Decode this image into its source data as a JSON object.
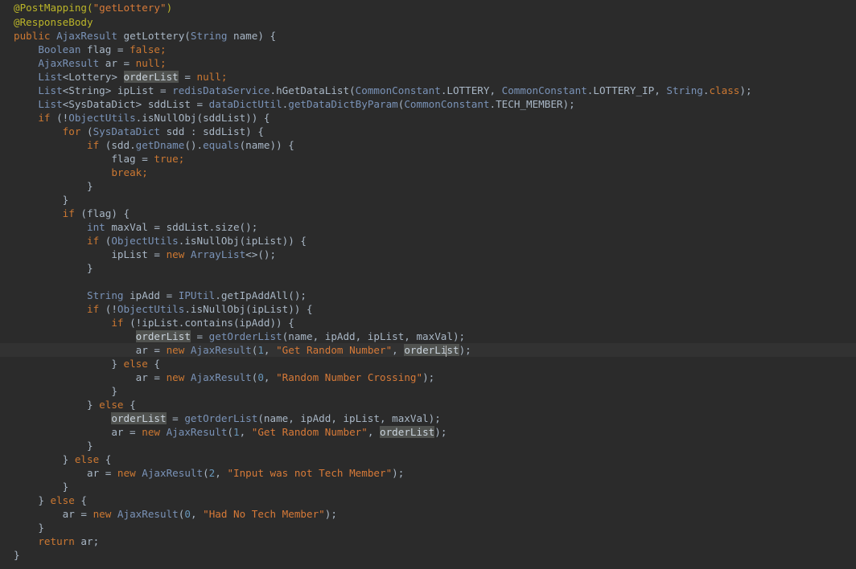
{
  "editor": {
    "colors": {
      "background": "#2b2b2b",
      "current_line": "#323232",
      "text": "#a9b7c6",
      "keyword": "#cc7832",
      "string": "#d77a38",
      "annotation": "#bbb529",
      "type": "#6897bb",
      "highlight": "#50524f"
    },
    "current_line_index": 25,
    "lines": [
      [
        {
          "t": "@PostMapping(",
          "c": "ann"
        },
        {
          "t": "\"getLottery\"",
          "c": "str"
        },
        {
          "t": ")",
          "c": "ann"
        }
      ],
      [
        {
          "t": "@ResponseBody",
          "c": "ann"
        }
      ],
      [
        {
          "t": "public ",
          "c": "kw"
        },
        {
          "t": "AjaxResult",
          "c": "cls"
        },
        {
          "t": " getLottery(",
          "c": "txt"
        },
        {
          "t": "String",
          "c": "cls"
        },
        {
          "t": " name) {",
          "c": "txt"
        }
      ],
      [
        {
          "t": "    ",
          "c": "txt"
        },
        {
          "t": "Boolean",
          "c": "cls"
        },
        {
          "t": " flag = ",
          "c": "txt"
        },
        {
          "t": "false",
          "c": "kw"
        },
        {
          "t": ";",
          "c": "kw"
        }
      ],
      [
        {
          "t": "    ",
          "c": "txt"
        },
        {
          "t": "AjaxResult",
          "c": "cls"
        },
        {
          "t": " ar = ",
          "c": "txt"
        },
        {
          "t": "null",
          "c": "kw"
        },
        {
          "t": ";",
          "c": "kw"
        }
      ],
      [
        {
          "t": "    ",
          "c": "txt"
        },
        {
          "t": "List",
          "c": "cls"
        },
        {
          "t": "<Lottery> ",
          "c": "txt"
        },
        {
          "t": "orderList",
          "c": "hl"
        },
        {
          "t": " = ",
          "c": "txt"
        },
        {
          "t": "null",
          "c": "kw"
        },
        {
          "t": ";",
          "c": "kw"
        }
      ],
      [
        {
          "t": "    ",
          "c": "txt"
        },
        {
          "t": "List",
          "c": "cls"
        },
        {
          "t": "<String> ipList = ",
          "c": "txt"
        },
        {
          "t": "redisDataService",
          "c": "cls"
        },
        {
          "t": ".hGetDataList(",
          "c": "txt"
        },
        {
          "t": "CommonConstant",
          "c": "cls"
        },
        {
          "t": ".LOTTERY, ",
          "c": "txt"
        },
        {
          "t": "CommonConstant",
          "c": "cls"
        },
        {
          "t": ".LOTTERY_IP, ",
          "c": "txt"
        },
        {
          "t": "String",
          "c": "cls"
        },
        {
          "t": ".",
          "c": "txt"
        },
        {
          "t": "class",
          "c": "kw"
        },
        {
          "t": ");",
          "c": "txt"
        }
      ],
      [
        {
          "t": "    ",
          "c": "txt"
        },
        {
          "t": "List",
          "c": "cls"
        },
        {
          "t": "<SysDataDict> sddList = ",
          "c": "txt"
        },
        {
          "t": "dataDictUtil",
          "c": "cls"
        },
        {
          "t": ".",
          "c": "txt"
        },
        {
          "t": "getDataDictByParam",
          "c": "cls"
        },
        {
          "t": "(",
          "c": "txt"
        },
        {
          "t": "CommonConstant",
          "c": "cls"
        },
        {
          "t": ".TECH_MEMBER);",
          "c": "txt"
        }
      ],
      [
        {
          "t": "    ",
          "c": "txt"
        },
        {
          "t": "if",
          "c": "kw"
        },
        {
          "t": " (!",
          "c": "txt"
        },
        {
          "t": "ObjectUtils",
          "c": "cls"
        },
        {
          "t": ".isNullObj(sddList)) {",
          "c": "txt"
        }
      ],
      [
        {
          "t": "        ",
          "c": "txt"
        },
        {
          "t": "for",
          "c": "kw"
        },
        {
          "t": " (",
          "c": "txt"
        },
        {
          "t": "SysDataDict",
          "c": "cls"
        },
        {
          "t": " sdd : sddList) {",
          "c": "txt"
        }
      ],
      [
        {
          "t": "            ",
          "c": "txt"
        },
        {
          "t": "if",
          "c": "kw"
        },
        {
          "t": " (sdd.",
          "c": "txt"
        },
        {
          "t": "getDname",
          "c": "cls"
        },
        {
          "t": "().",
          "c": "txt"
        },
        {
          "t": "equals",
          "c": "cls"
        },
        {
          "t": "(name)) {",
          "c": "txt"
        }
      ],
      [
        {
          "t": "                flag = ",
          "c": "txt"
        },
        {
          "t": "true",
          "c": "kw"
        },
        {
          "t": ";",
          "c": "kw"
        }
      ],
      [
        {
          "t": "                ",
          "c": "txt"
        },
        {
          "t": "break",
          "c": "kw"
        },
        {
          "t": ";",
          "c": "kw"
        }
      ],
      [
        {
          "t": "            }",
          "c": "txt"
        }
      ],
      [
        {
          "t": "        }",
          "c": "txt"
        }
      ],
      [
        {
          "t": "        ",
          "c": "txt"
        },
        {
          "t": "if",
          "c": "kw"
        },
        {
          "t": " (flag) {",
          "c": "txt"
        }
      ],
      [
        {
          "t": "            ",
          "c": "txt"
        },
        {
          "t": "int",
          "c": "cls"
        },
        {
          "t": " maxVal = sddList.size();",
          "c": "txt"
        }
      ],
      [
        {
          "t": "            ",
          "c": "txt"
        },
        {
          "t": "if",
          "c": "kw"
        },
        {
          "t": " (",
          "c": "txt"
        },
        {
          "t": "ObjectUtils",
          "c": "cls"
        },
        {
          "t": ".isNullObj(ipList)) {",
          "c": "txt"
        }
      ],
      [
        {
          "t": "                ipList = ",
          "c": "txt"
        },
        {
          "t": "new ",
          "c": "kw"
        },
        {
          "t": "ArrayList",
          "c": "cls"
        },
        {
          "t": "<>();",
          "c": "txt"
        }
      ],
      [
        {
          "t": "            }",
          "c": "txt"
        }
      ],
      [
        {
          "t": "",
          "c": "txt"
        }
      ],
      [
        {
          "t": "            ",
          "c": "txt"
        },
        {
          "t": "String",
          "c": "cls"
        },
        {
          "t": " ipAdd = ",
          "c": "txt"
        },
        {
          "t": "IPUtil",
          "c": "cls"
        },
        {
          "t": ".getIpAddAll();",
          "c": "txt"
        }
      ],
      [
        {
          "t": "            ",
          "c": "txt"
        },
        {
          "t": "if",
          "c": "kw"
        },
        {
          "t": " (!",
          "c": "txt"
        },
        {
          "t": "ObjectUtils",
          "c": "cls"
        },
        {
          "t": ".isNullObj(ipList)) {",
          "c": "txt"
        }
      ],
      [
        {
          "t": "                ",
          "c": "txt"
        },
        {
          "t": "if",
          "c": "kw"
        },
        {
          "t": " (!ipList.contains(ipAdd)) {",
          "c": "txt"
        }
      ],
      [
        {
          "t": "                    ",
          "c": "txt"
        },
        {
          "t": "orderList",
          "c": "hl"
        },
        {
          "t": " = ",
          "c": "txt"
        },
        {
          "t": "getOrderList",
          "c": "cls"
        },
        {
          "t": "(name, ipAdd, ipList, maxVal);",
          "c": "txt"
        }
      ],
      [
        {
          "t": "                    ar = ",
          "c": "txt"
        },
        {
          "t": "new ",
          "c": "kw"
        },
        {
          "t": "AjaxResult",
          "c": "cls"
        },
        {
          "t": "(",
          "c": "txt"
        },
        {
          "t": "1",
          "c": "num"
        },
        {
          "t": ", ",
          "c": "txt"
        },
        {
          "t": "\"Get Random Number\"",
          "c": "str"
        },
        {
          "t": ", ",
          "c": "txt"
        },
        {
          "t": "orderLi",
          "c": "hl"
        },
        {
          "t": "|",
          "c": "caret"
        },
        {
          "t": "st",
          "c": "hl"
        },
        {
          "t": ");",
          "c": "txt"
        }
      ],
      [
        {
          "t": "                } ",
          "c": "txt"
        },
        {
          "t": "else",
          "c": "kw"
        },
        {
          "t": " {",
          "c": "txt"
        }
      ],
      [
        {
          "t": "                    ar = ",
          "c": "txt"
        },
        {
          "t": "new ",
          "c": "kw"
        },
        {
          "t": "AjaxResult",
          "c": "cls"
        },
        {
          "t": "(",
          "c": "txt"
        },
        {
          "t": "0",
          "c": "num"
        },
        {
          "t": ", ",
          "c": "txt"
        },
        {
          "t": "\"Random Number Crossing\"",
          "c": "str"
        },
        {
          "t": ");",
          "c": "txt"
        }
      ],
      [
        {
          "t": "                }",
          "c": "txt"
        }
      ],
      [
        {
          "t": "            } ",
          "c": "txt"
        },
        {
          "t": "else",
          "c": "kw"
        },
        {
          "t": " {",
          "c": "txt"
        }
      ],
      [
        {
          "t": "                ",
          "c": "txt"
        },
        {
          "t": "orderList",
          "c": "hl"
        },
        {
          "t": " = ",
          "c": "txt"
        },
        {
          "t": "getOrderList",
          "c": "cls"
        },
        {
          "t": "(name, ipAdd, ipList, maxVal);",
          "c": "txt"
        }
      ],
      [
        {
          "t": "                ar = ",
          "c": "txt"
        },
        {
          "t": "new ",
          "c": "kw"
        },
        {
          "t": "AjaxResult",
          "c": "cls"
        },
        {
          "t": "(",
          "c": "txt"
        },
        {
          "t": "1",
          "c": "num"
        },
        {
          "t": ", ",
          "c": "txt"
        },
        {
          "t": "\"Get Random Number\"",
          "c": "str"
        },
        {
          "t": ", ",
          "c": "txt"
        },
        {
          "t": "orderList",
          "c": "hl"
        },
        {
          "t": ");",
          "c": "txt"
        }
      ],
      [
        {
          "t": "            }",
          "c": "txt"
        }
      ],
      [
        {
          "t": "        } ",
          "c": "txt"
        },
        {
          "t": "else",
          "c": "kw"
        },
        {
          "t": " {",
          "c": "txt"
        }
      ],
      [
        {
          "t": "            ar = ",
          "c": "txt"
        },
        {
          "t": "new ",
          "c": "kw"
        },
        {
          "t": "AjaxResult",
          "c": "cls"
        },
        {
          "t": "(",
          "c": "txt"
        },
        {
          "t": "2",
          "c": "num"
        },
        {
          "t": ", ",
          "c": "txt"
        },
        {
          "t": "\"Input was not Tech Member\"",
          "c": "str"
        },
        {
          "t": ");",
          "c": "txt"
        }
      ],
      [
        {
          "t": "        }",
          "c": "txt"
        }
      ],
      [
        {
          "t": "    } ",
          "c": "txt"
        },
        {
          "t": "else",
          "c": "kw"
        },
        {
          "t": " {",
          "c": "txt"
        }
      ],
      [
        {
          "t": "        ar = ",
          "c": "txt"
        },
        {
          "t": "new ",
          "c": "kw"
        },
        {
          "t": "AjaxResult",
          "c": "cls"
        },
        {
          "t": "(",
          "c": "txt"
        },
        {
          "t": "0",
          "c": "num"
        },
        {
          "t": ", ",
          "c": "txt"
        },
        {
          "t": "\"Had No Tech Member\"",
          "c": "str"
        },
        {
          "t": ");",
          "c": "txt"
        }
      ],
      [
        {
          "t": "    }",
          "c": "txt"
        }
      ],
      [
        {
          "t": "    ",
          "c": "txt"
        },
        {
          "t": "return",
          "c": "kw"
        },
        {
          "t": " ar;",
          "c": "txt"
        }
      ],
      [
        {
          "t": "}",
          "c": "txt"
        }
      ]
    ]
  }
}
